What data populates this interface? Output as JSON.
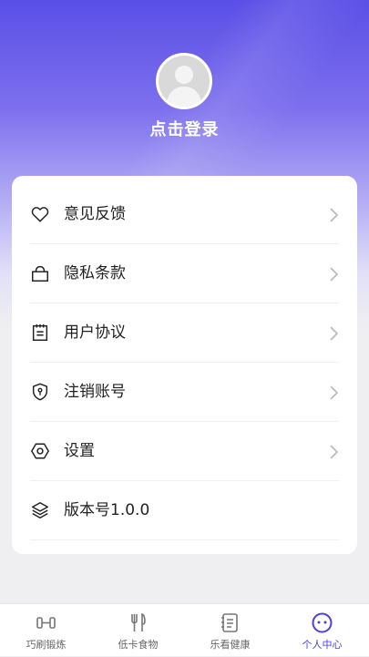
{
  "profile": {
    "login_label": "点击登录"
  },
  "menu": {
    "items": [
      {
        "label": "意见反馈",
        "icon": "heart-icon",
        "arrow": true
      },
      {
        "label": "隐私条款",
        "icon": "lock-icon",
        "arrow": true
      },
      {
        "label": "用户协议",
        "icon": "clipboard-icon",
        "arrow": true
      },
      {
        "label": "注销账号",
        "icon": "shield-icon",
        "arrow": true
      },
      {
        "label": "设置",
        "icon": "hexagon-settings-icon",
        "arrow": true
      },
      {
        "label": "版本号1.0.0",
        "icon": "layers-icon",
        "arrow": false
      }
    ]
  },
  "tabbar": {
    "tabs": [
      {
        "label": "巧刷锻炼",
        "icon": "dumbbell-icon",
        "active": false
      },
      {
        "label": "低卡食物",
        "icon": "fork-knife-icon",
        "active": false
      },
      {
        "label": "乐看健康",
        "icon": "notebook-icon",
        "active": false
      },
      {
        "label": "个人中心",
        "icon": "face-icon",
        "active": true
      }
    ]
  },
  "colors": {
    "accent": "#4b3fe0",
    "header_gradient_top": "#5a4fe6",
    "page_background": "#efeff1"
  }
}
